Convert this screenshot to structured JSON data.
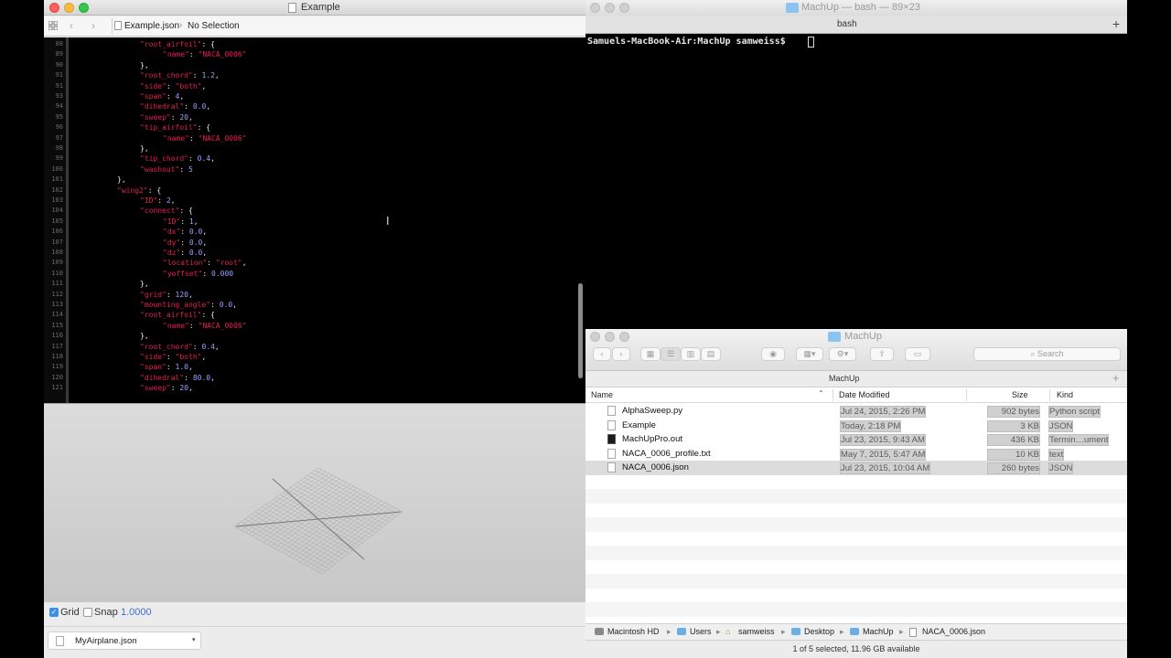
{
  "editor": {
    "window_title": "Example",
    "jumpbar": {
      "file": "Example.json",
      "selection": "No Selection"
    },
    "code_lines": [
      {
        "n": "88",
        "indent": 3,
        "parts": [
          {
            "k": "\"root_airfoil\""
          },
          {
            "p": ": {"
          }
        ]
      },
      {
        "n": "89",
        "indent": 4,
        "parts": [
          {
            "k": "\"name\""
          },
          {
            "p": ": "
          },
          {
            "k": "\"NACA_0006\""
          }
        ]
      },
      {
        "n": "90",
        "indent": 3,
        "parts": [
          {
            "p": "},"
          }
        ]
      },
      {
        "n": "91",
        "indent": 3,
        "parts": [
          {
            "k": "\"root_chord\""
          },
          {
            "p": ": "
          },
          {
            "v": "1.2"
          },
          {
            "p": ","
          }
        ]
      },
      {
        "n": "91",
        "indent": 3,
        "parts": [
          {
            "k": "\"side\""
          },
          {
            "p": ": "
          },
          {
            "k": "\"both\""
          },
          {
            "p": ","
          }
        ]
      },
      {
        "n": "93",
        "indent": 3,
        "parts": [
          {
            "k": "\"span\""
          },
          {
            "p": ": "
          },
          {
            "v": "4"
          },
          {
            "p": ","
          }
        ]
      },
      {
        "n": "94",
        "indent": 3,
        "parts": [
          {
            "k": "\"dihedral\""
          },
          {
            "p": ": "
          },
          {
            "v": "0.0"
          },
          {
            "p": ","
          }
        ]
      },
      {
        "n": "95",
        "indent": 3,
        "parts": [
          {
            "k": "\"sweep\""
          },
          {
            "p": ": "
          },
          {
            "v": "20"
          },
          {
            "p": ","
          }
        ]
      },
      {
        "n": "96",
        "indent": 3,
        "parts": [
          {
            "k": "\"tip_airfoil\""
          },
          {
            "p": ": {"
          }
        ]
      },
      {
        "n": "97",
        "indent": 4,
        "parts": [
          {
            "k": "\"name\""
          },
          {
            "p": ": "
          },
          {
            "k": "\"NACA_0006\""
          }
        ]
      },
      {
        "n": "98",
        "indent": 3,
        "parts": [
          {
            "p": "},"
          }
        ]
      },
      {
        "n": "99",
        "indent": 3,
        "parts": [
          {
            "k": "\"tip_chord\""
          },
          {
            "p": ": "
          },
          {
            "v": "0.4"
          },
          {
            "p": ","
          }
        ]
      },
      {
        "n": "100",
        "indent": 3,
        "parts": [
          {
            "k": "\"washout\""
          },
          {
            "p": ": "
          },
          {
            "v": "5"
          }
        ]
      },
      {
        "n": "101",
        "indent": 2,
        "parts": [
          {
            "p": "},"
          }
        ]
      },
      {
        "n": "102",
        "indent": 2,
        "parts": [
          {
            "k": "\"wing2\""
          },
          {
            "p": ": {"
          }
        ]
      },
      {
        "n": "103",
        "indent": 3,
        "parts": [
          {
            "k": "\"ID\""
          },
          {
            "p": ": "
          },
          {
            "v": "2"
          },
          {
            "p": ","
          }
        ]
      },
      {
        "n": "104",
        "indent": 3,
        "parts": [
          {
            "k": "\"connect\""
          },
          {
            "p": ": {"
          }
        ]
      },
      {
        "n": "105",
        "indent": 4,
        "parts": [
          {
            "k": "\"ID\""
          },
          {
            "p": ": "
          },
          {
            "v": "1"
          },
          {
            "p": ","
          }
        ]
      },
      {
        "n": "106",
        "indent": 4,
        "parts": [
          {
            "k": "\"dx\""
          },
          {
            "p": ": "
          },
          {
            "v": "0.0"
          },
          {
            "p": ","
          }
        ]
      },
      {
        "n": "107",
        "indent": 4,
        "parts": [
          {
            "k": "\"dy\""
          },
          {
            "p": ": "
          },
          {
            "v": "0.0"
          },
          {
            "p": ","
          }
        ]
      },
      {
        "n": "108",
        "indent": 4,
        "parts": [
          {
            "k": "\"dz\""
          },
          {
            "p": ": "
          },
          {
            "v": "0.0"
          },
          {
            "p": ","
          }
        ]
      },
      {
        "n": "109",
        "indent": 4,
        "parts": [
          {
            "k": "\"location\""
          },
          {
            "p": ": "
          },
          {
            "k": "\"root\""
          },
          {
            "p": ","
          }
        ]
      },
      {
        "n": "110",
        "indent": 4,
        "parts": [
          {
            "k": "\"yoffset\""
          },
          {
            "p": ": "
          },
          {
            "v": "0.000"
          }
        ]
      },
      {
        "n": "111",
        "indent": 3,
        "parts": [
          {
            "p": "},"
          }
        ]
      },
      {
        "n": "112",
        "indent": 3,
        "parts": [
          {
            "k": "\"grid\""
          },
          {
            "p": ": "
          },
          {
            "v": "120"
          },
          {
            "p": ","
          }
        ]
      },
      {
        "n": "113",
        "indent": 3,
        "parts": [
          {
            "k": "\"mounting_angle\""
          },
          {
            "p": ": "
          },
          {
            "v": "0.0"
          },
          {
            "p": ","
          }
        ]
      },
      {
        "n": "114",
        "indent": 3,
        "parts": [
          {
            "k": "\"root_airfoil\""
          },
          {
            "p": ": {"
          }
        ]
      },
      {
        "n": "115",
        "indent": 4,
        "parts": [
          {
            "k": "\"name\""
          },
          {
            "p": ": "
          },
          {
            "k": "\"NACA_0006\""
          }
        ]
      },
      {
        "n": "116",
        "indent": 3,
        "parts": [
          {
            "p": "},"
          }
        ]
      },
      {
        "n": "117",
        "indent": 3,
        "parts": [
          {
            "k": "\"root_chord\""
          },
          {
            "p": ": "
          },
          {
            "v": "0.4"
          },
          {
            "p": ","
          }
        ]
      },
      {
        "n": "118",
        "indent": 3,
        "parts": [
          {
            "k": "\"side\""
          },
          {
            "p": ": "
          },
          {
            "k": "\"both\""
          },
          {
            "p": ","
          }
        ]
      },
      {
        "n": "119",
        "indent": 3,
        "parts": [
          {
            "k": "\"span\""
          },
          {
            "p": ": "
          },
          {
            "v": "1.0"
          },
          {
            "p": ","
          }
        ]
      },
      {
        "n": "120",
        "indent": 3,
        "parts": [
          {
            "k": "\"dihedral\""
          },
          {
            "p": ": "
          },
          {
            "v": "80.0"
          },
          {
            "p": ","
          }
        ]
      },
      {
        "n": "121",
        "indent": 3,
        "parts": [
          {
            "k": "\"sweep\""
          },
          {
            "p": ": "
          },
          {
            "v": "20"
          },
          {
            "p": ","
          }
        ]
      }
    ],
    "bottombar": {
      "grid_label": "Grid",
      "grid_checked": true,
      "snap_label": "Snap",
      "snap_checked": false,
      "snap_value": "1.0000",
      "file_popup": "MyAirplane.json"
    }
  },
  "terminal": {
    "window_title": "MachUp — bash — 89×23",
    "tab_label": "bash",
    "prompt": "Samuels-MacBook-Air:MachUp samweiss$ "
  },
  "finder": {
    "window_title": "MachUp",
    "search_placeholder": "Search",
    "path_title": "MachUp",
    "columns": {
      "name": "Name",
      "date": "Date Modified",
      "size": "Size",
      "kind": "Kind"
    },
    "files": [
      {
        "name": "AlphaSweep.py",
        "date": "Jul 24, 2015, 2:26 PM",
        "size": "902 bytes",
        "kind": "Python script",
        "icon": "document-icon",
        "selected": false
      },
      {
        "name": "Example",
        "date": "Today, 2:18 PM",
        "size": "3 KB",
        "kind": "JSON",
        "icon": "document-icon",
        "selected": false
      },
      {
        "name": "MachUpPro.out",
        "date": "Jul 23, 2015, 9:43 AM",
        "size": "436 KB",
        "kind": "Termin…ument",
        "icon": "terminal-icon",
        "selected": false
      },
      {
        "name": "NACA_0006_profile.txt",
        "date": "May 7, 2015, 5:47 AM",
        "size": "10 KB",
        "kind": "text",
        "icon": "document-icon",
        "selected": false
      },
      {
        "name": "NACA_0006.json",
        "date": "Jul 23, 2015, 10:04 AM",
        "size": "260 bytes",
        "kind": "JSON",
        "icon": "document-icon",
        "selected": true
      }
    ],
    "path": [
      "Macintosh HD",
      "Users",
      "samweiss",
      "Desktop",
      "MachUp",
      "NACA_0006.json"
    ],
    "status": "1 of 5 selected, 11.96 GB available"
  }
}
